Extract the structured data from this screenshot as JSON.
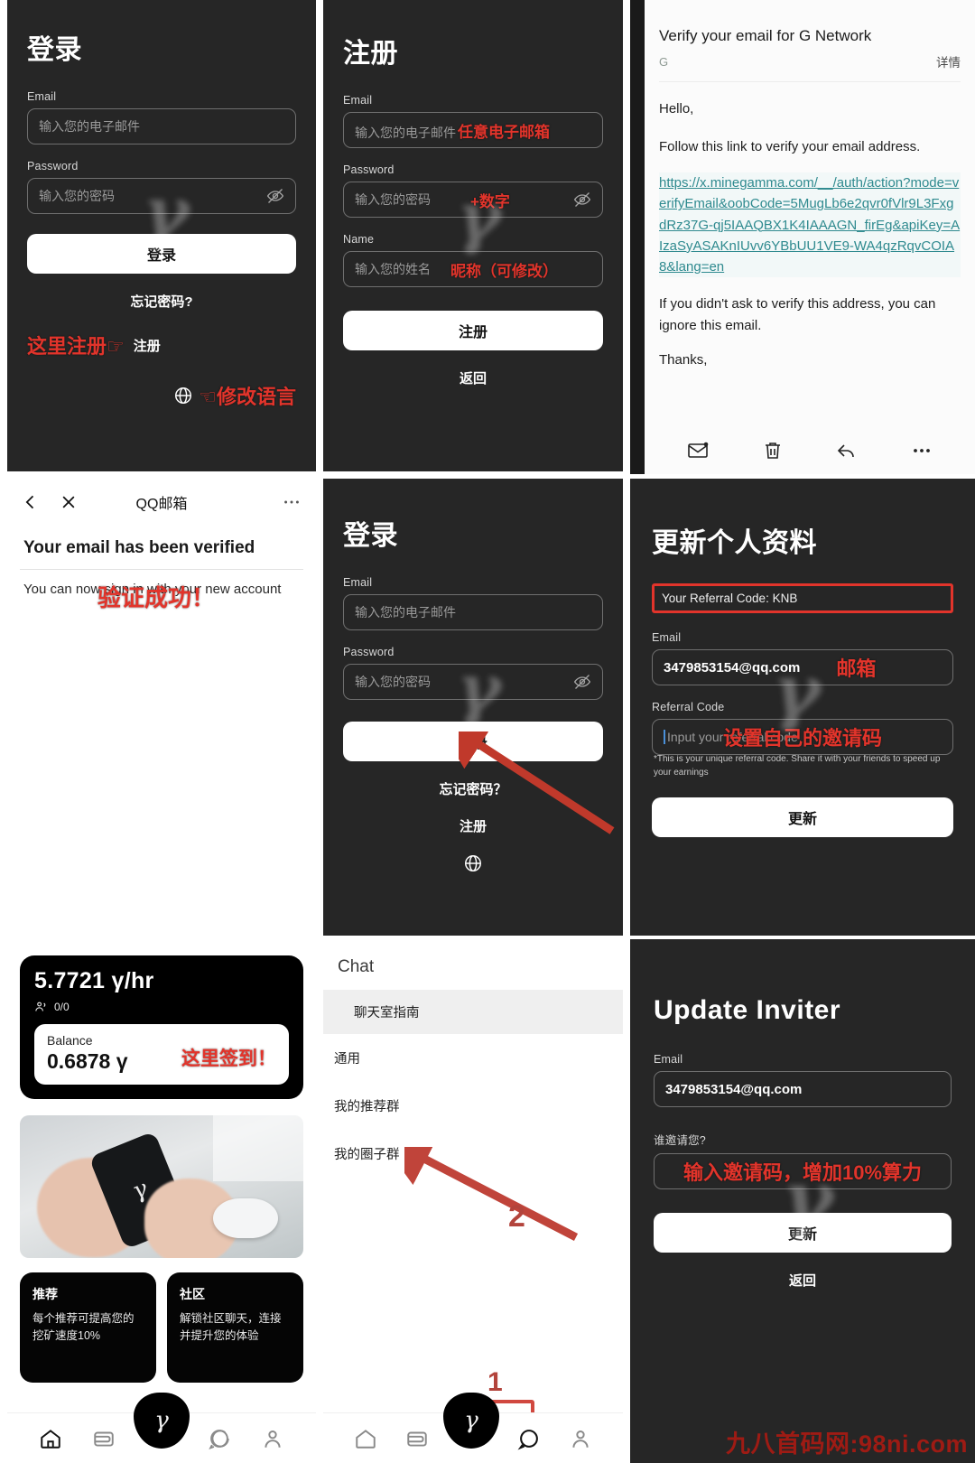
{
  "panel_login": {
    "title": "登录",
    "email_label": "Email",
    "email_placeholder": "输入您的电子邮件",
    "password_label": "Password",
    "password_placeholder": "输入您的密码",
    "login_button": "登录",
    "forgot_password": "忘记密码?",
    "register_link": "注册",
    "anno_register_here": "这里注册☞",
    "anno_change_language": "☜修改语言",
    "globe_icon": "globe-icon",
    "eye_icon": "eye-off-icon"
  },
  "panel_register": {
    "title": "注册",
    "email_label": "Email",
    "email_placeholder": "输入您的电子邮件",
    "anno_email": "任意电子邮箱",
    "password_label": "Password",
    "password_placeholder": "输入您的密码",
    "anno_password": "+数字",
    "name_label": "Name",
    "name_placeholder": "输入您的姓名",
    "anno_name": "昵称（可修改）",
    "register_button": "注册",
    "back_button": "返回",
    "eye_icon": "eye-off-icon"
  },
  "panel_mail": {
    "subject": "Verify your email for G Network",
    "from": "G",
    "detail_link": "详情",
    "greeting": "Hello,",
    "instruction": "Follow this link to verify your email address.",
    "verify_url": "https://x.minegamma.com/__/auth/action?mode=verifyEmail&oobCode=5MugLb6e2qvr0fVlr9L3FxgdRz37G-qj5IAAQBX1K4IAAAGN_firEg&apiKey=AIzaSyASAKnIUvv6YBbUU1VE9-WA4qzRqvCOIA8&lang=en",
    "disclaimer": "If you didn't ask to verify this address, you can ignore this email.",
    "thanks": "Thanks,",
    "actions": [
      "mail-unread-icon",
      "trash-icon",
      "reply-icon",
      "more-icon"
    ]
  },
  "panel_verified": {
    "app_title": "QQ邮箱",
    "back_icon": "back-chevron-icon",
    "close_icon": "close-icon",
    "more_icon": "more-icon",
    "heading": "Your email has been verified",
    "anno_success": "验证成功！",
    "body": "You can now sign in with your new account"
  },
  "panel_login2": {
    "title": "登录",
    "email_label": "Email",
    "email_placeholder": "输入您的电子邮件",
    "password_label": "Password",
    "password_placeholder": "输入您的密码",
    "login_button": "登录",
    "forgot_password": "忘记密码？",
    "register_link": "注册",
    "globe_icon": "globe-icon",
    "eye_icon": "eye-off-icon"
  },
  "panel_profile": {
    "title": "更新个人资料",
    "referral_banner": "Your Referral Code: KNB",
    "email_label": "Email",
    "email_value": "3479853154@qq.com",
    "anno_email": "邮箱",
    "referral_label": "Referral Code",
    "referral_placeholder": "Input your referral code",
    "anno_referral": "设置自己的邀请码",
    "hint": "*This is your unique referral code. Share it with your friends to speed up your earnings",
    "update_button": "更新"
  },
  "panel_dashboard": {
    "rate": "5.7721 γ/hr",
    "users_icon": "users-icon",
    "users_count": "0/0",
    "balance_label": "Balance",
    "balance_value": "0.6878 γ",
    "anno_checkin": "这里签到！",
    "tiles": [
      {
        "heading": "推荐",
        "body": "每个推荐可提高您的挖矿速度10%"
      },
      {
        "heading": "社区",
        "body": "解锁社区聊天，连接并提升您的体验"
      }
    ],
    "nav": [
      "home-icon",
      "wallet-icon",
      "gamma-fab-icon",
      "chat-icon",
      "profile-icon"
    ]
  },
  "panel_chat": {
    "title": "Chat",
    "rows": [
      "聊天室指南",
      "通用",
      "我的推荐群",
      "我的圈子群"
    ],
    "anno_step_2": "2",
    "anno_step_1": "1",
    "nav": [
      "home-icon",
      "wallet-icon",
      "gamma-fab-icon",
      "chat-icon",
      "profile-icon"
    ]
  },
  "panel_inviter": {
    "title": "Update Inviter",
    "email_label": "Email",
    "email_value": "3479853154@qq.com",
    "inviter_label": "谁邀请您?",
    "anno_inviter": "输入邀请码，增加10%算力",
    "update_button": "更新",
    "back_button": "返回"
  },
  "watermark": "九八首码网:98ni.com",
  "colors": {
    "annotation_red": "#e2342b",
    "panel_dark": "#262626",
    "link_teal": "#2f8a8f",
    "watermark_red": "#9e1b14"
  }
}
